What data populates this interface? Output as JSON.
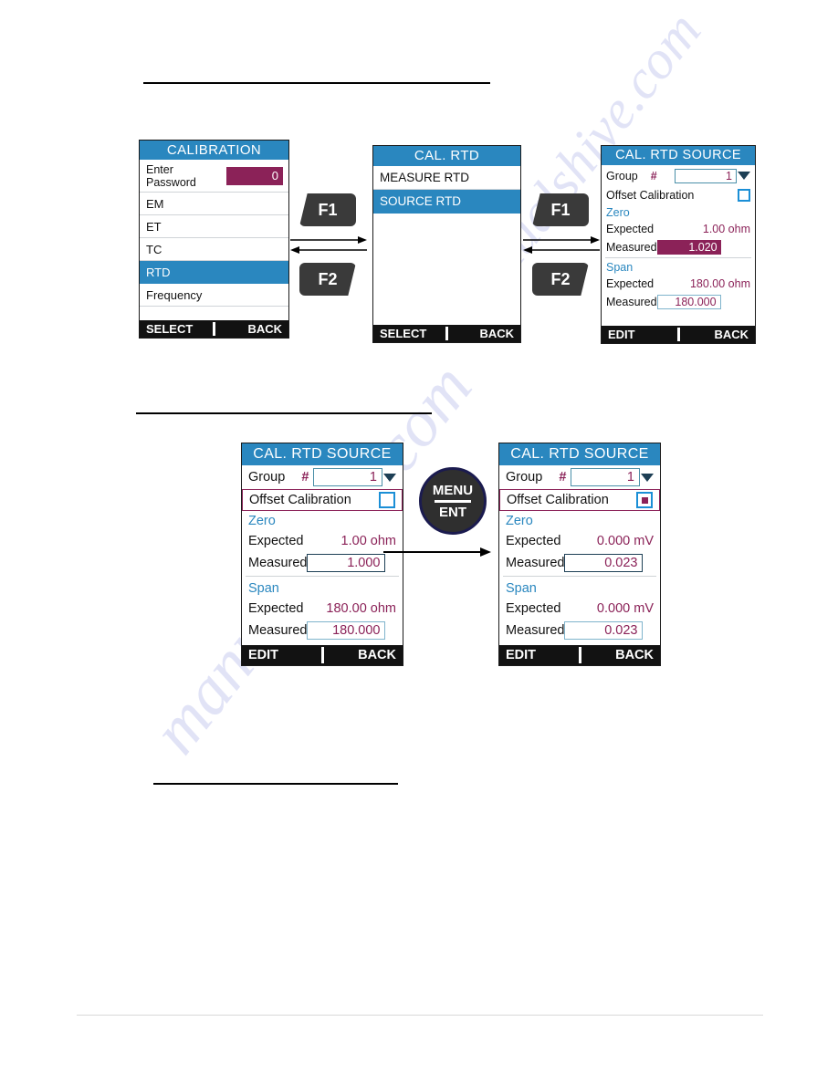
{
  "watermark": {
    "line1": "manualshive.com",
    "line2": "manualshive.com"
  },
  "fkeys": {
    "f1_a": "F1",
    "f2_a": "F2",
    "f1_b": "F1",
    "f2_b": "F2"
  },
  "menu_button": {
    "top": "MENU",
    "bottom": "ENT"
  },
  "panel_calibration": {
    "title": "CALIBRATION",
    "password_label_line1": "Enter",
    "password_label_line2": "Password",
    "password_value": "0",
    "items": [
      {
        "label": "EM",
        "selected": false
      },
      {
        "label": "ET",
        "selected": false
      },
      {
        "label": "TC",
        "selected": false
      },
      {
        "label": "RTD",
        "selected": true
      },
      {
        "label": "Frequency",
        "selected": false
      }
    ],
    "footer_left": "SELECT",
    "footer_right": "BACK"
  },
  "panel_cal_rtd": {
    "title": "CAL. RTD",
    "items": [
      {
        "label": "MEASURE RTD",
        "selected": false
      },
      {
        "label": "SOURCE RTD",
        "selected": true
      }
    ],
    "footer_left": "SELECT",
    "footer_right": "BACK"
  },
  "panel_source_top": {
    "title": "CAL. RTD SOURCE",
    "group_label": "Group",
    "group_hash": "#",
    "group_value": "1",
    "offset_label": "Offset Calibration",
    "offset_checked": false,
    "zero_label": "Zero",
    "zero_expected_label": "Expected",
    "zero_expected_value": "1.00 ohm",
    "zero_measured_label": "Measured",
    "zero_measured_value": "1.020",
    "span_label": "Span",
    "span_expected_label": "Expected",
    "span_expected_value": "180.00 ohm",
    "span_measured_label": "Measured",
    "span_measured_value": "180.000",
    "footer_left": "EDIT",
    "footer_right": "BACK"
  },
  "panel_source_before": {
    "title": "CAL. RTD SOURCE",
    "group_label": "Group",
    "group_hash": "#",
    "group_value": "1",
    "offset_label": "Offset Calibration",
    "offset_checked": false,
    "zero_label": "Zero",
    "zero_expected_label": "Expected",
    "zero_expected_value": "1.00 ohm",
    "zero_measured_label": "Measured",
    "zero_measured_value": "1.000",
    "span_label": "Span",
    "span_expected_label": "Expected",
    "span_expected_value": "180.00 ohm",
    "span_measured_label": "Measured",
    "span_measured_value": "180.000",
    "footer_left": "EDIT",
    "footer_right": "BACK"
  },
  "panel_source_after": {
    "title": "CAL. RTD SOURCE",
    "group_label": "Group",
    "group_hash": "#",
    "group_value": "1",
    "offset_label": "Offset Calibration",
    "offset_checked": true,
    "zero_label": "Zero",
    "zero_expected_label": "Expected",
    "zero_expected_value": "0.000 mV",
    "zero_measured_label": "Measured",
    "zero_measured_value": "0.023",
    "span_label": "Span",
    "span_expected_label": "Expected",
    "span_expected_value": "0.000 mV",
    "span_measured_label": "Measured",
    "span_measured_value": "0.023",
    "footer_left": "EDIT",
    "footer_right": "BACK"
  },
  "colors": {
    "header_blue": "#2a87bf",
    "accent_maroon": "#8b2258",
    "checkbox_blue": "#1b8fd6",
    "footer_black": "#121212",
    "section_label_blue": "#2a87bf"
  }
}
